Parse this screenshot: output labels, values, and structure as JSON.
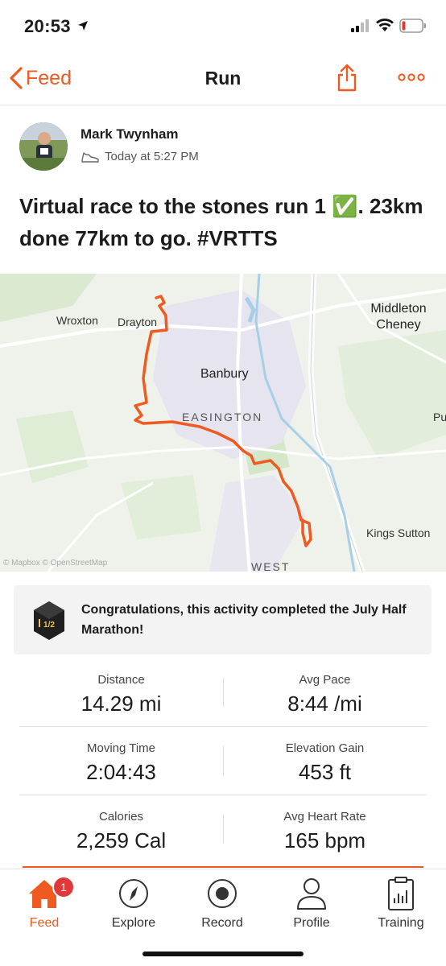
{
  "status_bar": {
    "time": "20:53"
  },
  "nav": {
    "back_label": "Feed",
    "title": "Run"
  },
  "activity": {
    "athlete": "Mark Twynham",
    "timestamp": "Today at 5:27 PM",
    "title": "Virtual race to the stones run 1 ✅. 23km done 77km to go. #VRTTS"
  },
  "map": {
    "labels": {
      "wroxton": "Wroxton",
      "drayton": "Drayton",
      "banbury": "Banbury",
      "easington": "EASINGTON",
      "middleton": "Middleton Cheney",
      "kings_sutton": "Kings Sutton",
      "west": "WEST",
      "pu": "Pu"
    },
    "attribution": "© Mapbox © OpenStreetMap",
    "route_color": "#ee5a1f"
  },
  "achievement": {
    "text": "Congratulations, this activity completed the July Half Marathon!",
    "badge_text": "1/2"
  },
  "stats": [
    {
      "left": {
        "label": "Distance",
        "value": "14.29 mi"
      },
      "right": {
        "label": "Avg Pace",
        "value": "8:44 /mi"
      }
    },
    {
      "left": {
        "label": "Moving Time",
        "value": "2:04:43"
      },
      "right": {
        "label": "Elevation Gain",
        "value": "453 ft"
      }
    },
    {
      "left": {
        "label": "Calories",
        "value": "2,259 Cal"
      },
      "right": {
        "label": "Avg Heart Rate",
        "value": "165 bpm"
      }
    }
  ],
  "tabs": [
    {
      "label": "Feed",
      "icon": "home-icon",
      "badge": "1"
    },
    {
      "label": "Explore",
      "icon": "compass-icon"
    },
    {
      "label": "Record",
      "icon": "record-icon"
    },
    {
      "label": "Profile",
      "icon": "person-icon"
    },
    {
      "label": "Training",
      "icon": "clipboard-chart-icon"
    }
  ],
  "colors": {
    "accent": "#ee5a1f",
    "badge_red": "#e0393b"
  }
}
